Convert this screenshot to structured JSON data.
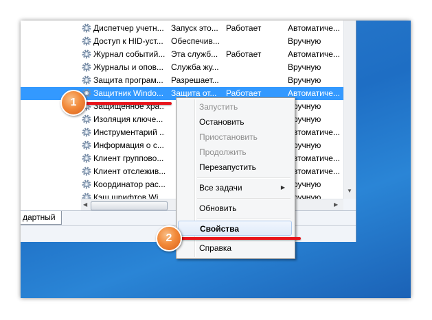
{
  "services": [
    {
      "name": "Диспетчер учетн...",
      "description": "Запуск это...",
      "status": "Работает",
      "startup": "Автоматиче..."
    },
    {
      "name": "Доступ к HID-уст...",
      "description": "Обеспечив...",
      "status": "",
      "startup": "Вручную"
    },
    {
      "name": "Журнал событий...",
      "description": "Эта служб...",
      "status": "Работает",
      "startup": "Автоматиче..."
    },
    {
      "name": "Журналы и опов...",
      "description": "Служба жу...",
      "status": "",
      "startup": "Вручную"
    },
    {
      "name": "Защита програм...",
      "description": "Разрешает...",
      "status": "",
      "startup": "Вручную"
    },
    {
      "name": "Защитник Windo...",
      "description": "Защита от...",
      "status": "Работает",
      "startup": "Автоматиче..."
    },
    {
      "name": "Защищенное хра...",
      "description": "",
      "status": "",
      "startup": "Вручную"
    },
    {
      "name": "Изоляция ключе...",
      "description": "",
      "status": "",
      "startup": "Вручную"
    },
    {
      "name": "Инструментарий ...",
      "description": "",
      "status": "",
      "startup": "Автоматиче..."
    },
    {
      "name": "Информация о с...",
      "description": "",
      "status": "",
      "startup": "Вручную"
    },
    {
      "name": "Клиент группово...",
      "description": "",
      "status": "",
      "startup": "Автоматиче..."
    },
    {
      "name": "Клиент отслежив...",
      "description": "",
      "status": "",
      "startup": "Автоматиче..."
    },
    {
      "name": "Координатор рас...",
      "description": "",
      "status": "",
      "startup": "Вручную"
    },
    {
      "name": "Кэш шрифтов Wi...",
      "description": "",
      "status": "",
      "startup": "Вручную"
    }
  ],
  "selected_index": 5,
  "tabs": {
    "standard": "дартный"
  },
  "context_menu": {
    "start": "Запустить",
    "stop": "Остановить",
    "pause": "Приостановить",
    "resume": "Продолжить",
    "restart": "Перезапустить",
    "all_tasks": "Все задачи",
    "refresh": "Обновить",
    "properties": "Свойства",
    "help": "Справка"
  },
  "callouts": {
    "first": "1",
    "second": "2"
  },
  "colors": {
    "selection": "#3399ff",
    "callout": "#f28a3a",
    "pointer_line": "#e8141b",
    "desktop": "#1e6ec4"
  },
  "icons": {
    "service": "gear-icon",
    "submenu": "arrow-right-icon"
  }
}
